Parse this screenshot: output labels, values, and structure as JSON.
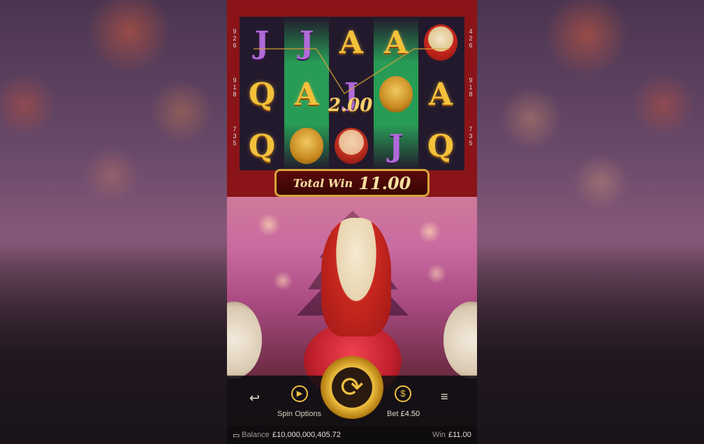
{
  "reels": {
    "columns": [
      {
        "symbols": [
          "J",
          "Q",
          "Q"
        ],
        "highlight": false
      },
      {
        "symbols": [
          "J",
          "A",
          "pot-icon"
        ],
        "highlight": true
      },
      {
        "symbols": [
          "A",
          "J",
          "boy-icon"
        ],
        "highlight": false
      },
      {
        "symbols": [
          "A",
          "pot-icon",
          "J"
        ],
        "highlight": true
      },
      {
        "symbols": [
          "drum-icon",
          "A",
          "Q"
        ],
        "highlight": false
      }
    ],
    "line_win": "2.00"
  },
  "left_side_numbers": [
    [
      "9",
      "2",
      "6"
    ],
    [
      "9",
      "1",
      "8"
    ],
    [
      "7",
      "3",
      "5"
    ]
  ],
  "right_side_numbers": [
    [
      "4",
      "2",
      "6"
    ],
    [
      "9",
      "1",
      "8"
    ],
    [
      "7",
      "3",
      "5"
    ]
  ],
  "total_win": {
    "label": "Total Win",
    "value": "11.00"
  },
  "controls": {
    "spin_options_label": "Spin Options",
    "bet_label": "Bet",
    "bet_value": "£4.50"
  },
  "status": {
    "balance_label": "Balance",
    "balance_value": "£10,000,000,405.72",
    "win_label": "Win",
    "win_value": "£11.00"
  },
  "colors": {
    "gold": "#f0c040",
    "reel_bg": "#221a2c",
    "frame": "#8a1418",
    "highlight": "#28aa5a"
  }
}
